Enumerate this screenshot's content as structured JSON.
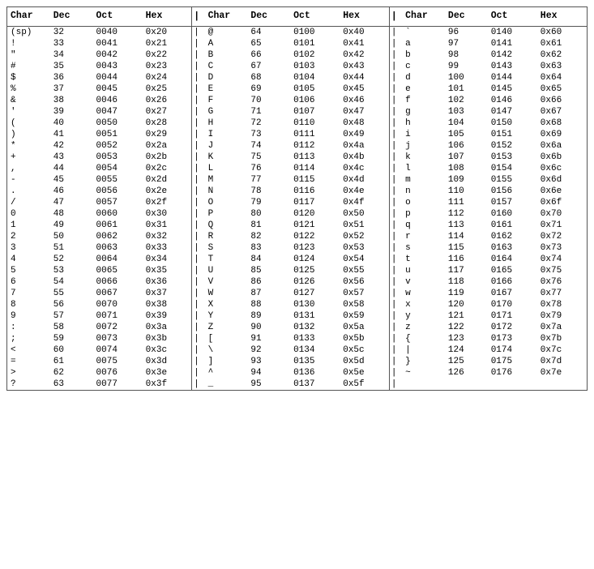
{
  "headers": [
    "Char",
    "Dec",
    "Oct",
    "Hex",
    "|",
    "Char",
    "Dec",
    "Oct",
    "Hex",
    "|",
    "Char",
    "Dec",
    "Oct",
    "Hex"
  ],
  "rows": [
    [
      "(sp)",
      "32",
      "0040",
      "0x20",
      "@",
      "64",
      "0100",
      "0x40",
      "`",
      "96",
      "0140",
      "0x60"
    ],
    [
      "!",
      "33",
      "0041",
      "0x21",
      "A",
      "65",
      "0101",
      "0x41",
      "a",
      "97",
      "0141",
      "0x61"
    ],
    [
      "\"",
      "34",
      "0042",
      "0x22",
      "B",
      "66",
      "0102",
      "0x42",
      "b",
      "98",
      "0142",
      "0x62"
    ],
    [
      "#",
      "35",
      "0043",
      "0x23",
      "C",
      "67",
      "0103",
      "0x43",
      "c",
      "99",
      "0143",
      "0x63"
    ],
    [
      "$",
      "36",
      "0044",
      "0x24",
      "D",
      "68",
      "0104",
      "0x44",
      "d",
      "100",
      "0144",
      "0x64"
    ],
    [
      "%",
      "37",
      "0045",
      "0x25",
      "E",
      "69",
      "0105",
      "0x45",
      "e",
      "101",
      "0145",
      "0x65"
    ],
    [
      "&",
      "38",
      "0046",
      "0x26",
      "F",
      "70",
      "0106",
      "0x46",
      "f",
      "102",
      "0146",
      "0x66"
    ],
    [
      "'",
      "39",
      "0047",
      "0x27",
      "G",
      "71",
      "0107",
      "0x47",
      "g",
      "103",
      "0147",
      "0x67"
    ],
    [
      "(",
      "40",
      "0050",
      "0x28",
      "H",
      "72",
      "0110",
      "0x48",
      "h",
      "104",
      "0150",
      "0x68"
    ],
    [
      ")",
      "41",
      "0051",
      "0x29",
      "I",
      "73",
      "0111",
      "0x49",
      "i",
      "105",
      "0151",
      "0x69"
    ],
    [
      "*",
      "42",
      "0052",
      "0x2a",
      "J",
      "74",
      "0112",
      "0x4a",
      "j",
      "106",
      "0152",
      "0x6a"
    ],
    [
      "+",
      "43",
      "0053",
      "0x2b",
      "K",
      "75",
      "0113",
      "0x4b",
      "k",
      "107",
      "0153",
      "0x6b"
    ],
    [
      ",",
      "44",
      "0054",
      "0x2c",
      "L",
      "76",
      "0114",
      "0x4c",
      "l",
      "108",
      "0154",
      "0x6c"
    ],
    [
      "-",
      "45",
      "0055",
      "0x2d",
      "M",
      "77",
      "0115",
      "0x4d",
      "m",
      "109",
      "0155",
      "0x6d"
    ],
    [
      ".",
      "46",
      "0056",
      "0x2e",
      "N",
      "78",
      "0116",
      "0x4e",
      "n",
      "110",
      "0156",
      "0x6e"
    ],
    [
      "/",
      "47",
      "0057",
      "0x2f",
      "O",
      "79",
      "0117",
      "0x4f",
      "o",
      "111",
      "0157",
      "0x6f"
    ],
    [
      "0",
      "48",
      "0060",
      "0x30",
      "P",
      "80",
      "0120",
      "0x50",
      "p",
      "112",
      "0160",
      "0x70"
    ],
    [
      "1",
      "49",
      "0061",
      "0x31",
      "Q",
      "81",
      "0121",
      "0x51",
      "q",
      "113",
      "0161",
      "0x71"
    ],
    [
      "2",
      "50",
      "0062",
      "0x32",
      "R",
      "82",
      "0122",
      "0x52",
      "r",
      "114",
      "0162",
      "0x72"
    ],
    [
      "3",
      "51",
      "0063",
      "0x33",
      "S",
      "83",
      "0123",
      "0x53",
      "s",
      "115",
      "0163",
      "0x73"
    ],
    [
      "4",
      "52",
      "0064",
      "0x34",
      "T",
      "84",
      "0124",
      "0x54",
      "t",
      "116",
      "0164",
      "0x74"
    ],
    [
      "5",
      "53",
      "0065",
      "0x35",
      "U",
      "85",
      "0125",
      "0x55",
      "u",
      "117",
      "0165",
      "0x75"
    ],
    [
      "6",
      "54",
      "0066",
      "0x36",
      "V",
      "86",
      "0126",
      "0x56",
      "v",
      "118",
      "0166",
      "0x76"
    ],
    [
      "7",
      "55",
      "0067",
      "0x37",
      "W",
      "87",
      "0127",
      "0x57",
      "w",
      "119",
      "0167",
      "0x77"
    ],
    [
      "8",
      "56",
      "0070",
      "0x38",
      "X",
      "88",
      "0130",
      "0x58",
      "x",
      "120",
      "0170",
      "0x78"
    ],
    [
      "9",
      "57",
      "0071",
      "0x39",
      "Y",
      "89",
      "0131",
      "0x59",
      "y",
      "121",
      "0171",
      "0x79"
    ],
    [
      ":",
      "58",
      "0072",
      "0x3a",
      "Z",
      "90",
      "0132",
      "0x5a",
      "z",
      "122",
      "0172",
      "0x7a"
    ],
    [
      ";",
      "59",
      "0073",
      "0x3b",
      "[",
      "91",
      "0133",
      "0x5b",
      "{",
      "123",
      "0173",
      "0x7b"
    ],
    [
      "<",
      "60",
      "0074",
      "0x3c",
      "\\",
      "92",
      "0134",
      "0x5c",
      "|",
      "124",
      "0174",
      "0x7c"
    ],
    [
      "=",
      "61",
      "0075",
      "0x3d",
      "]",
      "93",
      "0135",
      "0x5d",
      "}",
      "125",
      "0175",
      "0x7d"
    ],
    [
      ">",
      "62",
      "0076",
      "0x3e",
      "^",
      "94",
      "0136",
      "0x5e",
      "~",
      "126",
      "0176",
      "0x7e"
    ],
    [
      "?",
      "63",
      "0077",
      "0x3f",
      "_",
      "95",
      "0137",
      "0x5f",
      "",
      "",
      "",
      ""
    ]
  ]
}
